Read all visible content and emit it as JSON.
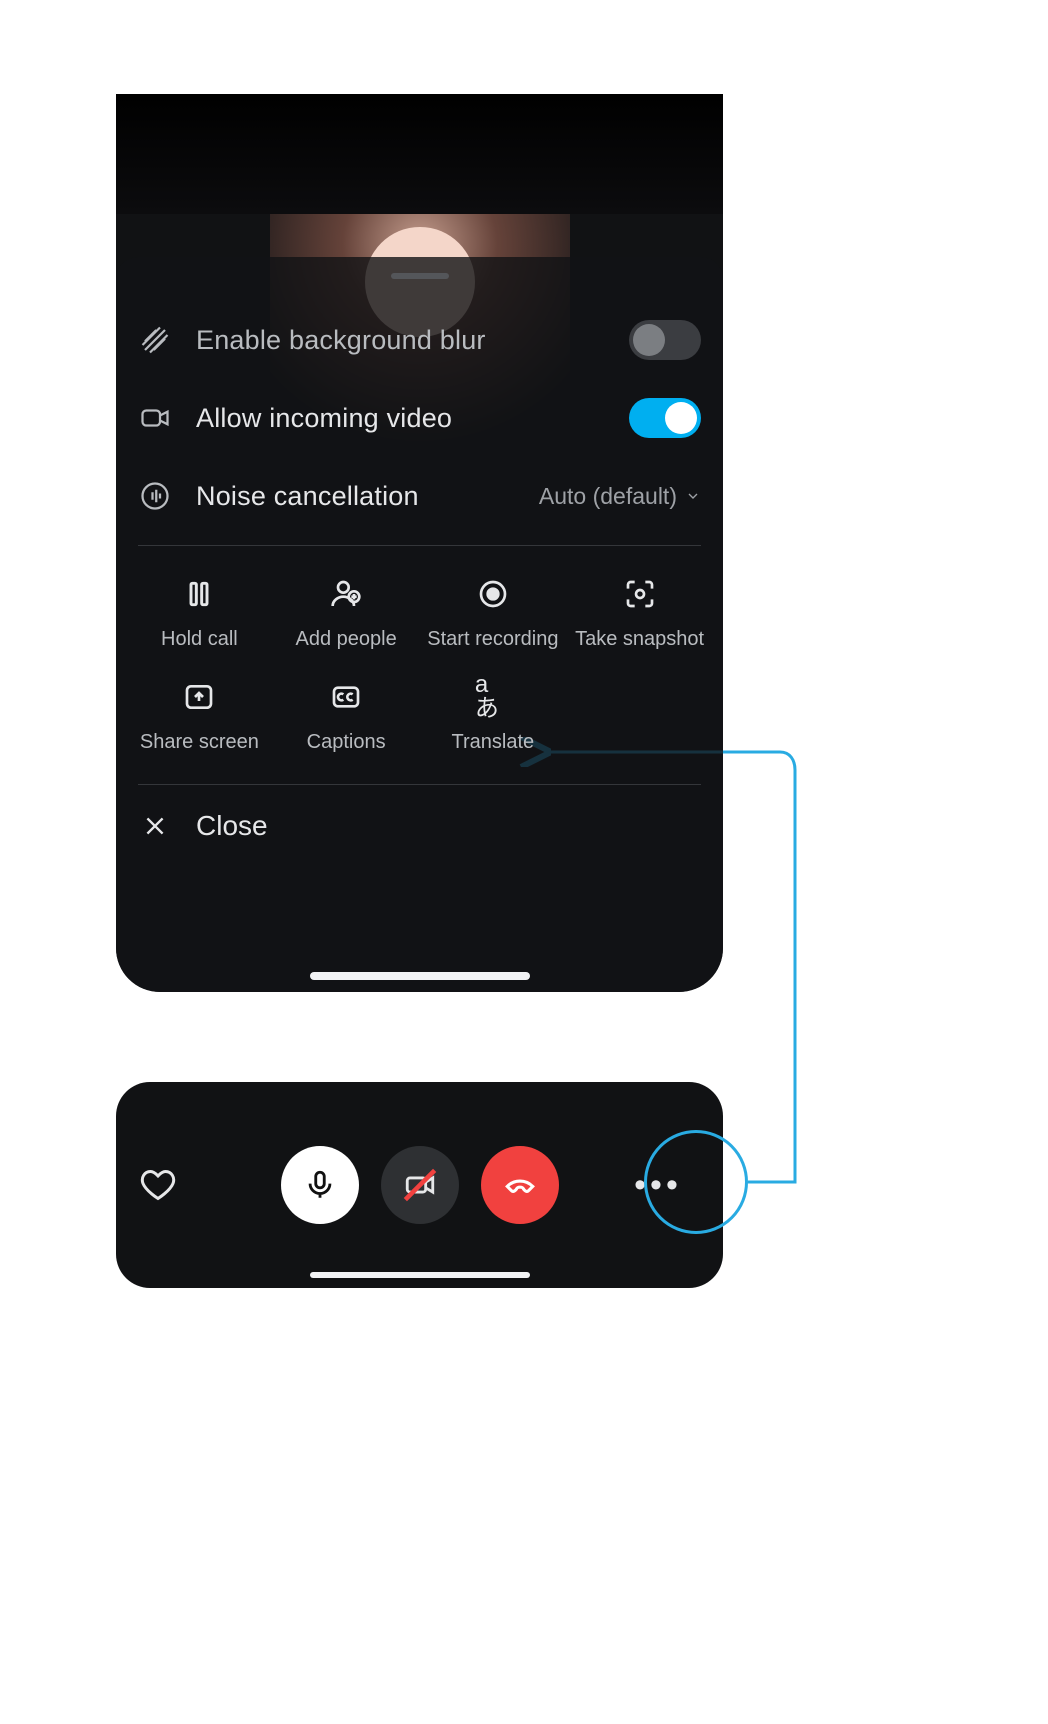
{
  "settings": {
    "blur": {
      "label": "Enable background blur",
      "on": false
    },
    "video": {
      "label": "Allow incoming video",
      "on": true
    },
    "noise": {
      "label": "Noise cancellation",
      "value": "Auto (default)"
    }
  },
  "actions": {
    "hold": {
      "label": "Hold call"
    },
    "add": {
      "label": "Add people"
    },
    "record": {
      "label": "Start recording"
    },
    "snapshot": {
      "label": "Take snapshot"
    },
    "share": {
      "label": "Share screen"
    },
    "captions": {
      "label": "Captions"
    },
    "translate": {
      "label": "Translate"
    }
  },
  "close": {
    "label": "Close"
  },
  "colors": {
    "accent": "#00aff0",
    "hangup": "#f1413f",
    "annotation": "#29abe2"
  }
}
